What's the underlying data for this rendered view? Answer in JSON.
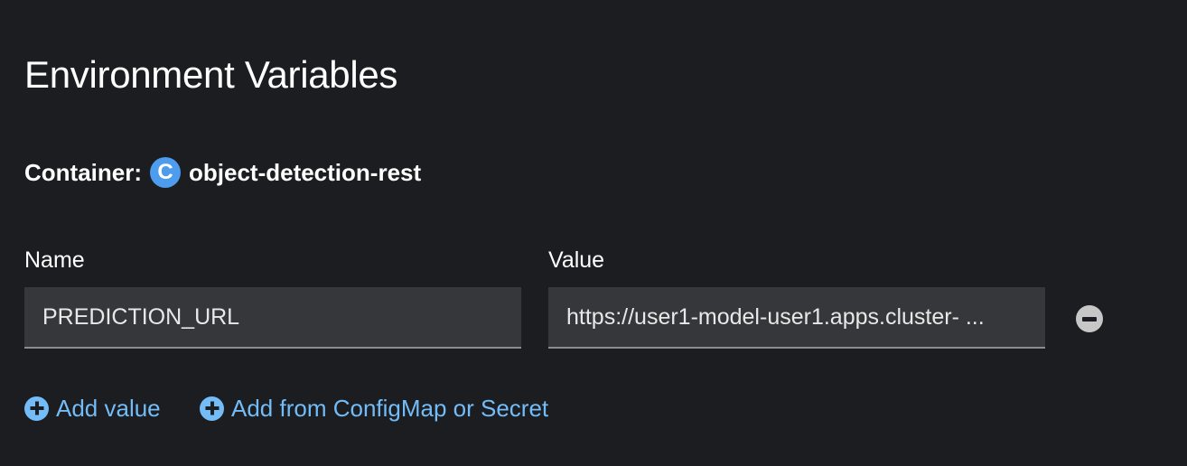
{
  "page": {
    "title": "Environment Variables"
  },
  "container": {
    "label": "Container:",
    "badge": "C",
    "name": "object-detection-rest"
  },
  "columns": {
    "name_label": "Name",
    "value_label": "Value"
  },
  "env_rows": [
    {
      "name": "PREDICTION_URL",
      "value": "https://user1-model-user1.apps.cluster- ..."
    }
  ],
  "actions": {
    "add_value": "Add value",
    "add_from": "Add from ConfigMap or Secret"
  },
  "icons": {
    "remove": "minus-circle-icon",
    "add": "plus-circle-icon"
  },
  "colors": {
    "background": "#1b1d21",
    "field_background": "#36373a",
    "link": "#73bcf7",
    "container_badge": "#4d9ced",
    "remove_icon": "#c7c7c7"
  }
}
